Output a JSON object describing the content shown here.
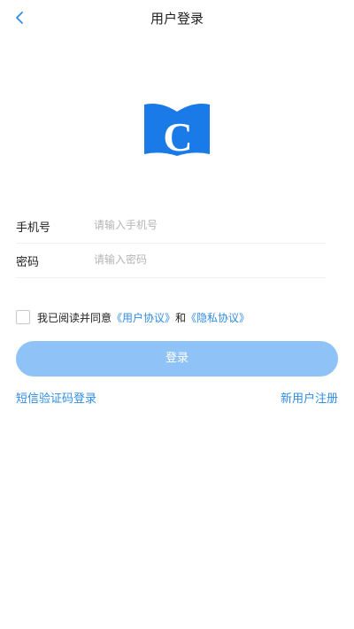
{
  "header": {
    "title": "用户登录",
    "back_icon": "chevron-left-icon"
  },
  "logo": {
    "letter": "C",
    "color": "#1a7ae8"
  },
  "form": {
    "phone_label": "手机号",
    "phone_placeholder": "请输入手机号",
    "password_label": "密码",
    "password_placeholder": "请输入密码"
  },
  "agreement": {
    "checked": false,
    "prefix": "我已阅读并同意",
    "user_agreement": "《用户协议》",
    "conjunction": "和",
    "privacy_agreement": "《隐私协议》"
  },
  "login_button": {
    "label": "登录",
    "color": "#8fc3f7"
  },
  "footer": {
    "sms_login": "短信验证码登录",
    "register": "新用户注册"
  },
  "accent_color": "#2f8ce5"
}
